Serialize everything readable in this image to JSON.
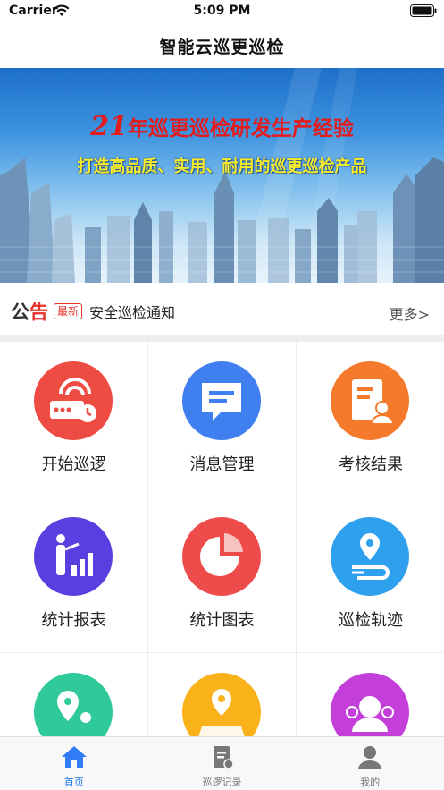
{
  "status_bar": {
    "carrier": "Carrier",
    "time": "5:09 PM"
  },
  "nav": {
    "title": "智能云巡更巡检"
  },
  "banner": {
    "line1_number": "21",
    "line1_text": "年巡更巡检研发生产经验",
    "line2": "打造高品质、实用、耐用的巡更巡检产品"
  },
  "notice": {
    "logo_part1": "公",
    "logo_part2": "告",
    "badge": "最新",
    "text": "安全巡检通知",
    "more": "更多>"
  },
  "menu": {
    "items": [
      {
        "label": "开始巡逻",
        "icon": "patrol-device-icon",
        "color": "#ee4b43"
      },
      {
        "label": "消息管理",
        "icon": "message-icon",
        "color": "#3f7ff0"
      },
      {
        "label": "考核结果",
        "icon": "assessment-icon",
        "color": "#f57a2c"
      },
      {
        "label": "统计报表",
        "icon": "report-icon",
        "color": "#5a3fe0"
      },
      {
        "label": "统计图表",
        "icon": "pie-chart-icon",
        "color": "#ee4b4b"
      },
      {
        "label": "巡检轨迹",
        "icon": "track-icon",
        "color": "#2ea0ee"
      },
      {
        "label": "",
        "icon": "location-person-icon",
        "color": "#2fc99a"
      },
      {
        "label": "",
        "icon": "map-pin-icon",
        "color": "#f9b21a"
      },
      {
        "label": "",
        "icon": "group-icon",
        "color": "#c43fd9"
      }
    ]
  },
  "tabs": [
    {
      "label": "首页",
      "icon": "home-icon",
      "active": true
    },
    {
      "label": "巡逻记录",
      "icon": "record-icon",
      "active": false
    },
    {
      "label": "我的",
      "icon": "profile-icon",
      "active": false
    }
  ],
  "colors": {
    "accent": "#1a73e8",
    "notice_red": "#e5312a"
  }
}
